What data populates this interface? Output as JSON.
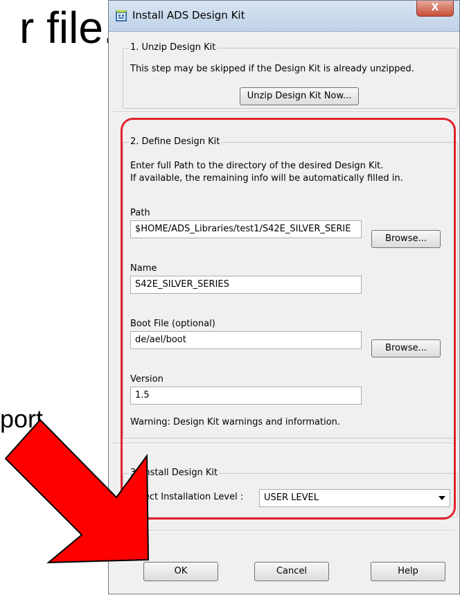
{
  "background": {
    "file_text": "r file.",
    "port_text": "port"
  },
  "dialog": {
    "title": "Install ADS Design Kit",
    "close_label": "X"
  },
  "section1": {
    "legend": "1. Unzip Design Kit",
    "description": "This step may be skipped if the Design Kit is already unzipped.",
    "unzip_button": "Unzip Design Kit Now..."
  },
  "section2": {
    "legend": "2. Define Design Kit",
    "description_line1": "Enter full Path to the directory of the desired Design Kit.",
    "description_line2": "If available, the remaining info will be automatically filled in.",
    "path_label": "Path",
    "path_value": "$HOME/ADS_Libraries/test1/S42E_SILVER_SERIE",
    "browse_label": "Browse...",
    "name_label": "Name",
    "name_value": "S42E_SILVER_SERIES",
    "bootfile_label": "Boot File (optional)",
    "bootfile_value": "de/ael/boot",
    "version_label": "Version",
    "version_value": "1.5",
    "warning": "Warning: Design Kit warnings and information."
  },
  "section3": {
    "legend": "3. Install Design Kit",
    "level_label": "Select Installation Level :",
    "level_value": "USER LEVEL"
  },
  "footer": {
    "ok": "OK",
    "cancel": "Cancel",
    "help": "Help"
  },
  "colors": {
    "highlight": "#e0222b",
    "arrow": "#ff0000"
  }
}
